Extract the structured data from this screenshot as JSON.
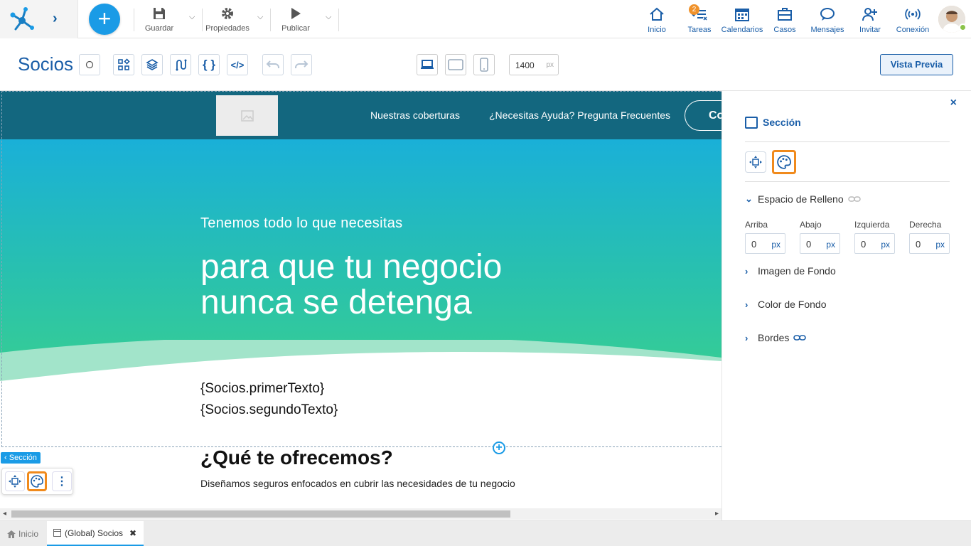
{
  "topbar": {
    "toolbar": [
      {
        "label": "Guardar",
        "icon": "save-icon"
      },
      {
        "label": "Propiedades",
        "icon": "gear-icon"
      },
      {
        "label": "Publicar",
        "icon": "play-icon"
      }
    ],
    "nav": [
      {
        "label": "Inicio",
        "icon": "home-icon"
      },
      {
        "label": "Tareas",
        "icon": "tasks-icon",
        "badge": "2"
      },
      {
        "label": "Calendarios",
        "icon": "calendar-icon"
      },
      {
        "label": "Casos",
        "icon": "briefcase-icon"
      },
      {
        "label": "Mensajes",
        "icon": "chat-icon"
      },
      {
        "label": "Invitar",
        "icon": "invite-user-icon"
      },
      {
        "label": "Conexión",
        "icon": "connection-icon"
      }
    ],
    "user_status_color": "#8bc34a"
  },
  "editor": {
    "page_title": "Socios",
    "width_value": "1400",
    "width_unit": "px",
    "preview_label": "Vista Previa"
  },
  "canvas": {
    "menu": [
      "Nuestras coberturas",
      "¿Necesitas Ayuda? Pregunta Frecuentes"
    ],
    "contact_button": "Co",
    "hero_subtitle": "Tenemos todo lo que necesitas",
    "hero_title_line1": "para que tu negocio",
    "hero_title_line2": "nunca se detenga",
    "var_text_1": "{Socios.primerTexto}",
    "var_text_2": "{Socios.segundoTexto}",
    "section_tag": "Sección",
    "offer_title": "¿Qué te ofrecemos?",
    "offer_subtitle": "Diseñamos seguros enfocados en cubrir las necesidades de tu negocio",
    "colors": {
      "header": "#13677f",
      "hero_top": "#1ab0d8",
      "hero_bottom": "#39d08e"
    }
  },
  "panel": {
    "close": "×",
    "title": "Sección",
    "padding_title": "Espacio de Relleno",
    "padding_fields": [
      {
        "label": "Arriba",
        "value": "0",
        "unit": "px"
      },
      {
        "label": "Abajo",
        "value": "0",
        "unit": "px"
      },
      {
        "label": "Izquierda",
        "value": "0",
        "unit": "px"
      },
      {
        "label": "Derecha",
        "value": "0",
        "unit": "px"
      }
    ],
    "background_image": "Imagen de Fondo",
    "background_color": "Color de Fondo",
    "borders": "Bordes"
  },
  "bottom_tabs": [
    {
      "label": "Inicio",
      "icon": "home-icon"
    },
    {
      "label": "(Global) Socios",
      "icon": "page-icon",
      "close": "✖"
    }
  ]
}
